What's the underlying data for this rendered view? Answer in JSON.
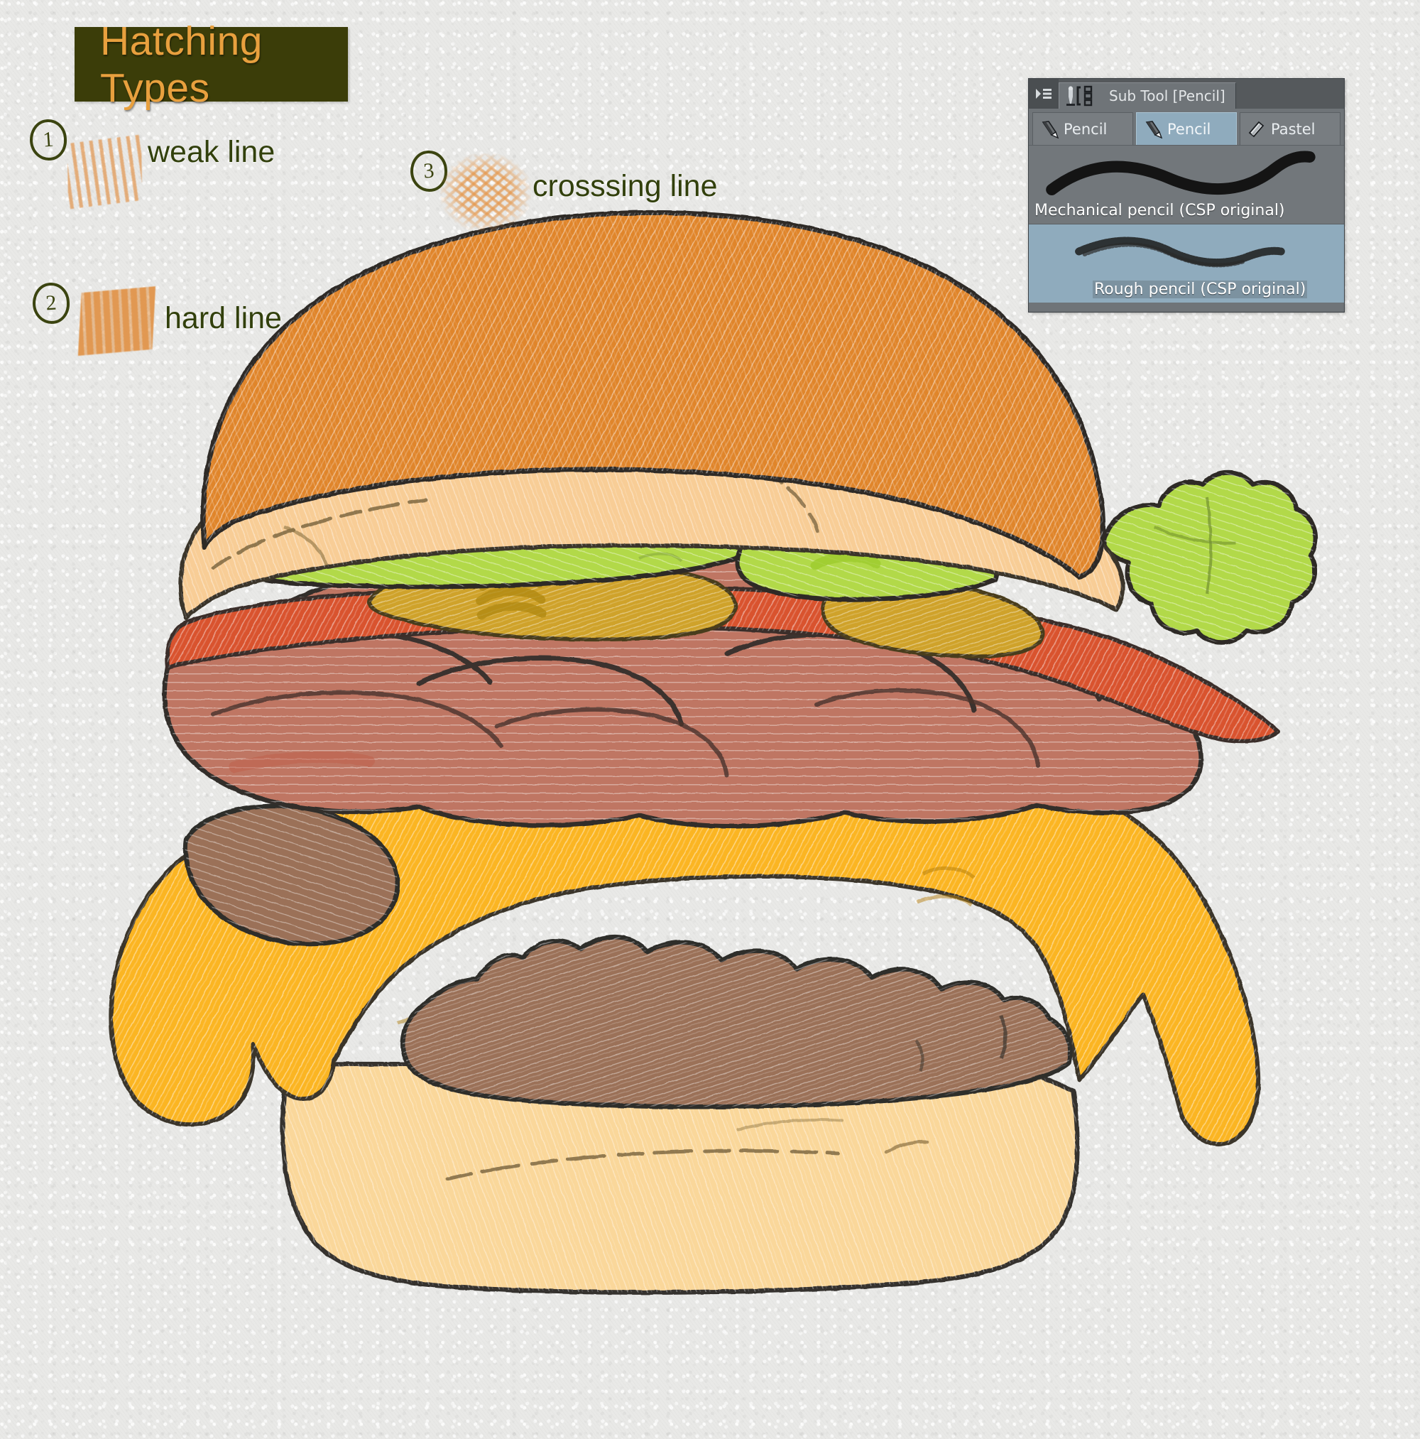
{
  "page": {
    "background_color": "#e9e9e7",
    "title_box_color": "#3b3d09",
    "title_text_color": "#e8a03e",
    "label_text_color": "#32400c"
  },
  "title": {
    "text": "Hatching Types"
  },
  "legend": {
    "items": [
      {
        "number": "1",
        "label": "weak line",
        "swatch": "weak-hatch-swatch",
        "color": "#e2964f"
      },
      {
        "number": "2",
        "label": "hard line",
        "swatch": "hard-hatch-swatch",
        "color": "#e1944a"
      },
      {
        "number": "3",
        "label": "crosssing line",
        "swatch": "crossing-hatch-swatch",
        "color": "#e4984e"
      }
    ]
  },
  "subtool_panel": {
    "menu_icon": "panel-menu-icon",
    "tab_icon": "subtool-icon",
    "tab_title": "Sub Tool [Pencil]",
    "tool_tabs": [
      {
        "label": "Pencil",
        "icon": "pencil-icon",
        "active": false
      },
      {
        "label": "Pencil",
        "icon": "pencil-icon",
        "active": true
      },
      {
        "label": "Pastel",
        "icon": "pastel-icon",
        "active": false
      }
    ],
    "brushes": [
      {
        "name": "Mechanical pencil (CSP original)",
        "selected": false,
        "stroke": "smooth-stroke-preview"
      },
      {
        "name": "Rough pencil (CSP original)",
        "selected": true,
        "stroke": "rough-stroke-preview"
      }
    ],
    "colors": {
      "panel_bg": "#6f7478",
      "titlebar_bg": "#55595c",
      "selection_blue": "#8fabbd",
      "text": "#e9edf0"
    }
  },
  "illustration": {
    "name": "hand-drawn-hamburger",
    "layers": [
      {
        "name": "top-bun",
        "color": "#e0852b"
      },
      {
        "name": "bun-crumb",
        "color": "#f8cd96"
      },
      {
        "name": "lettuce",
        "color": "#b2d94a"
      },
      {
        "name": "pickle",
        "color": "#cfa229"
      },
      {
        "name": "tomato",
        "color": "#d9532f"
      },
      {
        "name": "bacon",
        "color": "#bf7663"
      },
      {
        "name": "cheese",
        "color": "#fbb524"
      },
      {
        "name": "beef-patty",
        "color": "#9b7158"
      },
      {
        "name": "bottom-bun",
        "color": "#fad79a"
      },
      {
        "name": "outline-ink",
        "color": "#2f2f33"
      }
    ]
  }
}
